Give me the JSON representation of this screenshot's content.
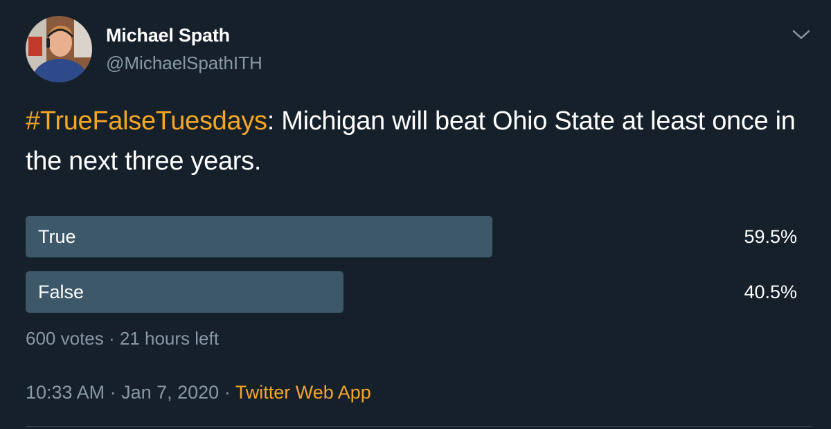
{
  "user": {
    "display_name": "Michael Spath",
    "handle": "@MichaelSpathITH"
  },
  "tweet": {
    "hashtag": "#TrueFalseTuesdays",
    "text": ": Michigan will beat Ohio State at least once in the next three years."
  },
  "poll": {
    "options": [
      {
        "label": "True",
        "percent": 59.5,
        "percent_text": "59.5%"
      },
      {
        "label": "False",
        "percent": 40.5,
        "percent_text": "40.5%"
      }
    ],
    "votes": "600 votes",
    "separator": " · ",
    "time_left": "21 hours left"
  },
  "meta": {
    "time": "10:33 AM",
    "separator": " · ",
    "date": "Jan 7, 2020",
    "separator2": " · ",
    "source": "Twitter Web App"
  },
  "colors": {
    "background": "#15202b",
    "accent": "#f5a623",
    "poll_bar": "#3c5869",
    "secondary_text": "#8899a6"
  },
  "icons": {
    "menu": "chevron-down-icon"
  }
}
